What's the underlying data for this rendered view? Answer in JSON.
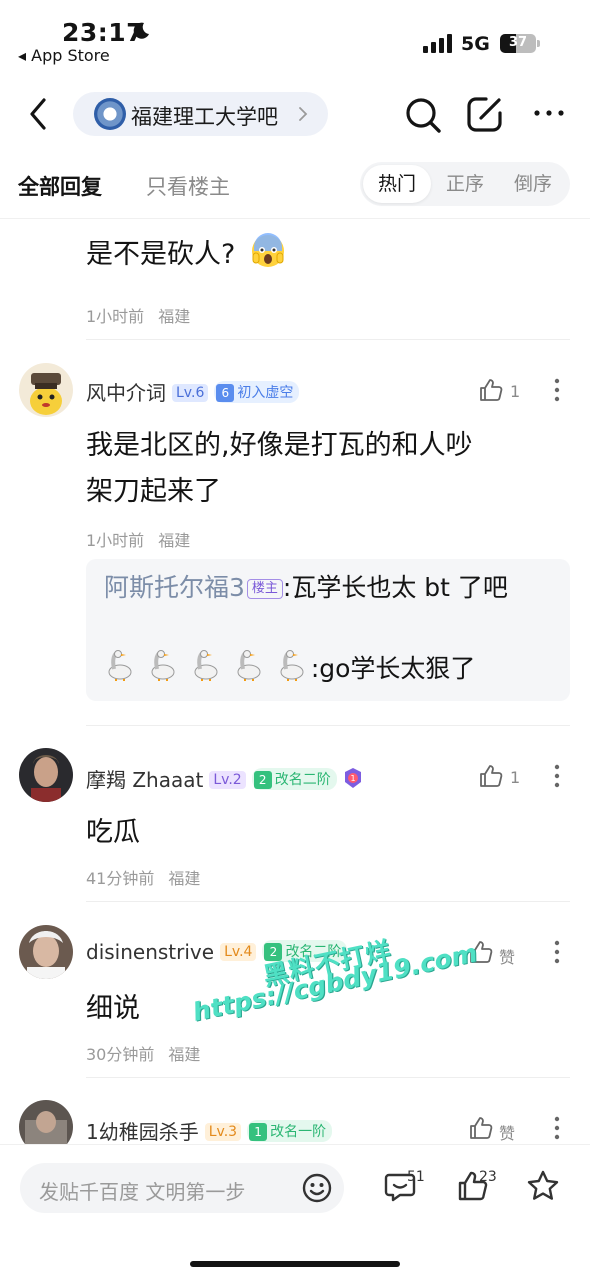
{
  "status": {
    "time": "23:17",
    "back_app": "◂ App Store",
    "network": "5G",
    "battery": "37"
  },
  "nav": {
    "forum_name": "福建理工大学吧"
  },
  "tabs": {
    "all_replies": "全部回复",
    "op_only": "只看楼主",
    "sort": [
      "热门",
      "正序",
      "倒序"
    ]
  },
  "comments": [
    {
      "text": "是不是砍人?",
      "time": "1小时前",
      "location": "福建"
    },
    {
      "user": "风中介词",
      "level": "Lv.6",
      "badge_num": "6",
      "badge_text": "初入虚空",
      "likes": "1",
      "text_line1": "我是北区的,好像是打瓦的和人吵",
      "text_line2": "架刀起来了",
      "time": "1小时前",
      "location": "福建",
      "replies": [
        {
          "user": "阿斯托尔福3",
          "tag": "楼主",
          "text": ":瓦学长也太 bt 了吧"
        },
        {
          "text": ":go学长太狠了"
        }
      ]
    },
    {
      "user": "摩羯 Zhaaat",
      "level": "Lv.2",
      "badge_num": "2",
      "badge_text": "改名二阶",
      "likes": "1",
      "text": "吃瓜",
      "time": "41分钟前",
      "location": "福建"
    },
    {
      "user": "disinenstrive",
      "level": "Lv.4",
      "badge_num": "2",
      "badge_text": "改名二阶",
      "likes": "赞",
      "text": "细说",
      "time": "30分钟前",
      "location": "福建"
    },
    {
      "user": "1幼稚园杀手",
      "level": "Lv.3",
      "badge_num": "1",
      "badge_text": "改名一阶",
      "likes": "赞"
    }
  ],
  "watermark": {
    "line1": "黑料不打烊",
    "line2": "https://cgbdy19.com"
  },
  "bottom": {
    "compose_placeholder": "发贴千百度 文明第一步",
    "comment_count": "51",
    "like_count": "23"
  },
  "colors": {
    "accent_blue": "#4a6fd8",
    "watermark": "#4fe0c4"
  }
}
